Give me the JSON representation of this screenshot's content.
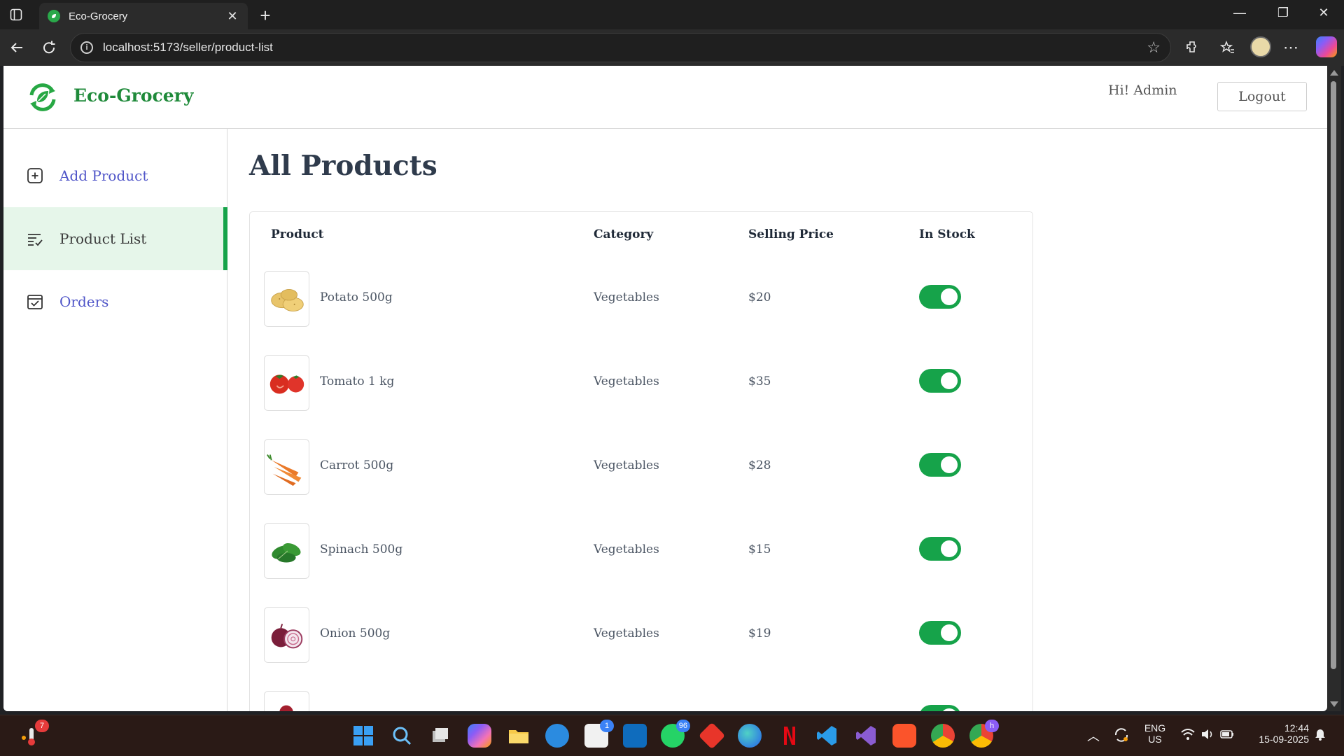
{
  "browser": {
    "tab_title": "Eco-Grocery",
    "tab_close": "✕",
    "new_tab": "+",
    "url": "localhost:5173/seller/product-list",
    "window_controls": {
      "minimize": "—",
      "maximize": "❐",
      "close": "✕"
    }
  },
  "header": {
    "logo_text": "Eco-Grocery",
    "greeting": "Hi! Admin",
    "logout_label": "Logout"
  },
  "sidebar": {
    "items": [
      {
        "label": "Add Product",
        "icon": "add-square-icon",
        "active": false
      },
      {
        "label": "Product List",
        "icon": "list-check-icon",
        "active": true
      },
      {
        "label": "Orders",
        "icon": "calendar-check-icon",
        "active": false
      }
    ]
  },
  "main": {
    "title": "All Products",
    "columns": {
      "product": "Product",
      "category": "Category",
      "price": "Selling Price",
      "stock": "In Stock"
    },
    "rows": [
      {
        "name": "Potato 500g",
        "category": "Vegetables",
        "price": "$20",
        "in_stock": true,
        "image": "potato-image"
      },
      {
        "name": "Tomato 1 kg",
        "category": "Vegetables",
        "price": "$35",
        "in_stock": true,
        "image": "tomato-image"
      },
      {
        "name": "Carrot 500g",
        "category": "Vegetables",
        "price": "$28",
        "in_stock": true,
        "image": "carrot-image"
      },
      {
        "name": "Spinach 500g",
        "category": "Vegetables",
        "price": "$15",
        "in_stock": true,
        "image": "spinach-image"
      },
      {
        "name": "Onion 500g",
        "category": "Vegetables",
        "price": "$19",
        "in_stock": true,
        "image": "onion-image"
      }
    ]
  },
  "taskbar": {
    "weather_badge": "7",
    "store_badge": "1",
    "whatsapp_badge": "96",
    "chrome_badge": "h",
    "lang_line1": "ENG",
    "lang_line2": "US",
    "time": "12:44",
    "date": "15-09-2025"
  },
  "colors": {
    "brand_green": "#1f8a3a",
    "toggle_on": "#16a34a",
    "active_bg": "#e6f6ea",
    "link": "#4f55c8"
  }
}
